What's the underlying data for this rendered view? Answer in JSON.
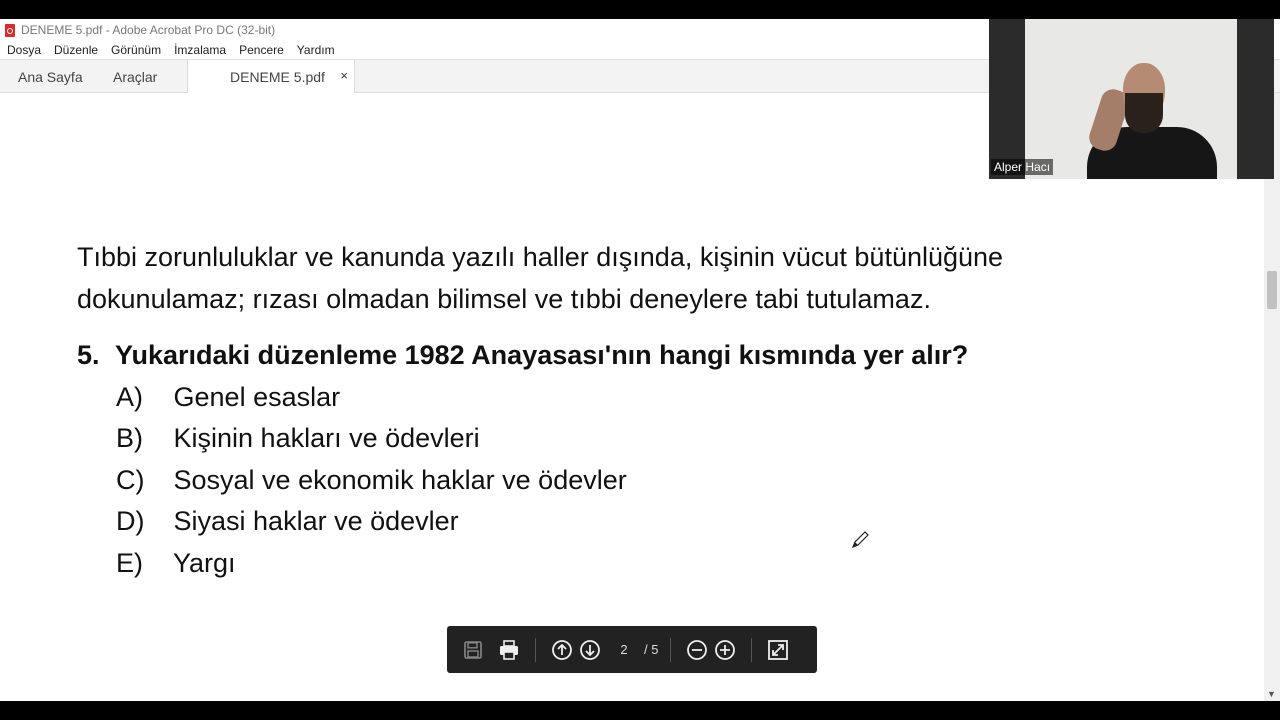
{
  "window": {
    "title": "DENEME 5.pdf - Adobe Acrobat Pro DC (32-bit)"
  },
  "menu": [
    "Dosya",
    "Düzenle",
    "Görünüm",
    "İmzalama",
    "Pencere",
    "Yardım"
  ],
  "tabs": {
    "home": "Ana Sayfa",
    "tools": "Araçlar",
    "document": "DENEME 5.pdf",
    "close": "×"
  },
  "question": {
    "paragraph_line1": "Tıbbi zorunluluklar ve kanunda yazılı haller dışında, kişinin vücut bütünlüğüne",
    "paragraph_line2": "dokunulamaz; rızası olmadan bilimsel ve tıbbi deneylere tabi tutulamaz.",
    "number": "5.",
    "text": "Yukarıdaki düzenleme 1982 Anayasası'nın hangi kısmında yer alır?",
    "options": [
      {
        "label": "A)",
        "text": "Genel esaslar"
      },
      {
        "label": "B)",
        "text": "Kişinin hakları ve ödevleri"
      },
      {
        "label": "C)",
        "text": "Sosyal ve ekonomik haklar ve ödevler"
      },
      {
        "label": "D)",
        "text": "Siyasi haklar ve ödevler"
      },
      {
        "label": "E)",
        "text": "Yargı"
      }
    ]
  },
  "toolbar": {
    "current_page": "2",
    "total_pages": "/ 5"
  },
  "video": {
    "participant_name": "Alper Hacı"
  },
  "icons": {
    "save": "save-icon",
    "print": "print-icon",
    "prev": "arrow-up-circle-icon",
    "next": "arrow-down-circle-icon",
    "zoom_out": "zoom-out-icon",
    "zoom_in": "zoom-in-icon",
    "fit": "fit-page-icon",
    "pen": "pen-cursor-icon"
  }
}
